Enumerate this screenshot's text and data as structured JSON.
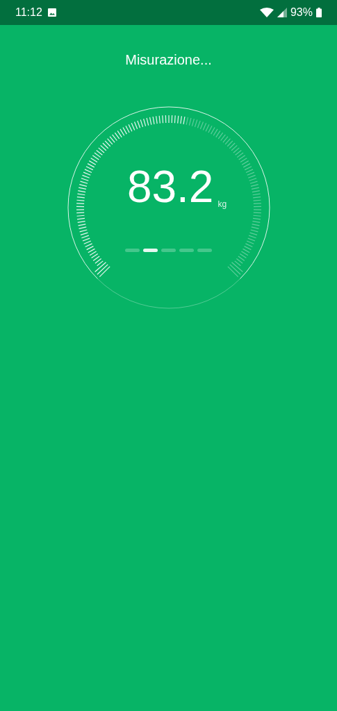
{
  "status_bar": {
    "time": "11:12",
    "battery": "93%"
  },
  "title": "Misurazione...",
  "gauge": {
    "value": "83.2",
    "unit": "kg"
  },
  "progress_dashes": [
    {
      "selected": false
    },
    {
      "selected": true
    },
    {
      "selected": false
    },
    {
      "selected": false
    },
    {
      "selected": false
    }
  ]
}
